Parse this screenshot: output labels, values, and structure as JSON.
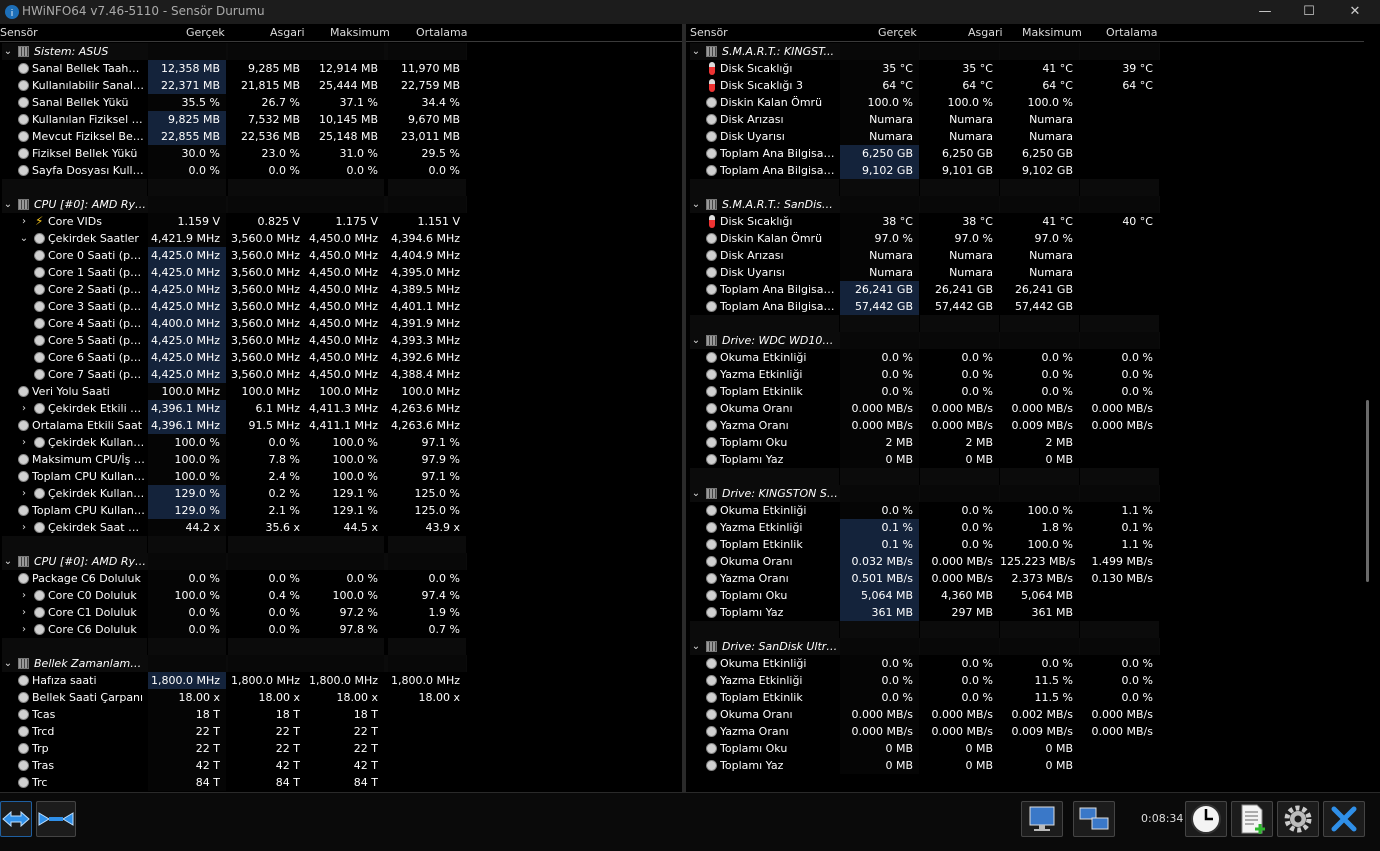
{
  "window": {
    "title": "HWiNFO64 v7.46-5110 - Sensör Durumu",
    "minimize": "—",
    "maximize": "☐",
    "close": "✕"
  },
  "headers": {
    "sensor": "Sensör",
    "current": "Gerçek",
    "min": "Asgari",
    "max": "Maksimum",
    "avg": "Ortalama"
  },
  "status": {
    "timer": "0:08:34"
  },
  "left_rows": [
    {
      "t": "g",
      "n": "Sistem: ASUS"
    },
    {
      "i": "c",
      "n": "Sanal Bellek Taahhüt...",
      "v": [
        "12,358 MB",
        "9,285 MB",
        "12,914 MB",
        "11,970 MB"
      ],
      "h": 1
    },
    {
      "i": "c",
      "n": "Kullanılabilir Sanal Be...",
      "v": [
        "22,371 MB",
        "21,815 MB",
        "25,444 MB",
        "22,759 MB"
      ],
      "h": 1
    },
    {
      "i": "c",
      "n": "Sanal Bellek Yükü",
      "v": [
        "35.5 %",
        "26.7 %",
        "37.1 %",
        "34.4 %"
      ]
    },
    {
      "i": "c",
      "n": "Kullanılan Fiziksel Bellek",
      "v": [
        "9,825 MB",
        "7,532 MB",
        "10,145 MB",
        "9,670 MB"
      ],
      "h": 1
    },
    {
      "i": "c",
      "n": "Mevcut Fiziksel Bellek",
      "v": [
        "22,855 MB",
        "22,536 MB",
        "25,148 MB",
        "23,011 MB"
      ],
      "h": 1
    },
    {
      "i": "c",
      "n": "Fiziksel Bellek Yükü",
      "v": [
        "30.0 %",
        "23.0 %",
        "31.0 %",
        "29.5 %"
      ]
    },
    {
      "i": "c",
      "n": "Sayfa Dosyası Kullanımı",
      "v": [
        "0.0 %",
        "0.0 %",
        "0.0 %",
        "0.0 %"
      ]
    },
    {
      "t": "s"
    },
    {
      "t": "g",
      "n": "CPU [#0]: AMD Ryz..."
    },
    {
      "e": ">",
      "i": "v",
      "n": "Core VIDs",
      "v": [
        "1.159 V",
        "0.825 V",
        "1.175 V",
        "1.151 V"
      ]
    },
    {
      "e": "v",
      "i": "c",
      "n": "Çekirdek Saatler",
      "v": [
        "4,421.9 MHz",
        "3,560.0 MHz",
        "4,450.0 MHz",
        "4,394.6 MHz"
      ]
    },
    {
      "d": 1,
      "i": "c",
      "n": "Core 0 Saati (per...",
      "v": [
        "4,425.0 MHz",
        "3,560.0 MHz",
        "4,450.0 MHz",
        "4,404.9 MHz"
      ],
      "h": 1
    },
    {
      "d": 1,
      "i": "c",
      "n": "Core 1 Saati (per...",
      "v": [
        "4,425.0 MHz",
        "3,560.0 MHz",
        "4,450.0 MHz",
        "4,395.0 MHz"
      ],
      "h": 1
    },
    {
      "d": 1,
      "i": "c",
      "n": "Core 2 Saati (per...",
      "v": [
        "4,425.0 MHz",
        "3,560.0 MHz",
        "4,450.0 MHz",
        "4,389.5 MHz"
      ],
      "h": 1
    },
    {
      "d": 1,
      "i": "c",
      "n": "Core 3 Saati (per...",
      "v": [
        "4,425.0 MHz",
        "3,560.0 MHz",
        "4,450.0 MHz",
        "4,401.1 MHz"
      ],
      "h": 1
    },
    {
      "d": 1,
      "i": "c",
      "n": "Core 4 Saati (per...",
      "v": [
        "4,400.0 MHz",
        "3,560.0 MHz",
        "4,450.0 MHz",
        "4,391.9 MHz"
      ],
      "h": 1
    },
    {
      "d": 1,
      "i": "c",
      "n": "Core 5 Saati (per...",
      "v": [
        "4,425.0 MHz",
        "3,560.0 MHz",
        "4,450.0 MHz",
        "4,393.3 MHz"
      ],
      "h": 1
    },
    {
      "d": 1,
      "i": "c",
      "n": "Core 6 Saati (per...",
      "v": [
        "4,425.0 MHz",
        "3,560.0 MHz",
        "4,450.0 MHz",
        "4,392.6 MHz"
      ],
      "h": 1
    },
    {
      "d": 1,
      "i": "c",
      "n": "Core 7 Saati (per...",
      "v": [
        "4,425.0 MHz",
        "3,560.0 MHz",
        "4,450.0 MHz",
        "4,388.4 MHz"
      ],
      "h": 1
    },
    {
      "i": "c",
      "n": "Veri Yolu Saati",
      "v": [
        "100.0 MHz",
        "100.0 MHz",
        "100.0 MHz",
        "100.0 MHz"
      ]
    },
    {
      "e": ">",
      "i": "c",
      "n": "Çekirdek Etkili Sa...",
      "v": [
        "4,396.1 MHz",
        "6.1 MHz",
        "4,411.3 MHz",
        "4,263.6 MHz"
      ],
      "h": 1
    },
    {
      "i": "c",
      "n": "Ortalama Etkili Saat",
      "v": [
        "4,396.1 MHz",
        "91.5 MHz",
        "4,411.1 MHz",
        "4,263.6 MHz"
      ],
      "h": 1
    },
    {
      "e": ">",
      "i": "c",
      "n": "Çekirdek Kullanım",
      "v": [
        "100.0 %",
        "0.0 %",
        "100.0 %",
        "97.1 %"
      ]
    },
    {
      "i": "c",
      "n": "Maksimum CPU/İş pa...",
      "v": [
        "100.0 %",
        "7.8 %",
        "100.0 %",
        "97.9 %"
      ]
    },
    {
      "i": "c",
      "n": "Toplam CPU Kullanımı",
      "v": [
        "100.0 %",
        "2.4 %",
        "100.0 %",
        "97.1 %"
      ]
    },
    {
      "e": ">",
      "i": "c",
      "n": "Çekirdek Kullanım",
      "v": [
        "129.0 %",
        "0.2 %",
        "129.1 %",
        "125.0 %"
      ],
      "h": 1
    },
    {
      "i": "c",
      "n": "Toplam CPU Kullanımı",
      "v": [
        "129.0 %",
        "2.1 %",
        "129.1 %",
        "125.0 %"
      ],
      "h": 1
    },
    {
      "e": ">",
      "i": "c",
      "n": "Çekirdek Saat Ça...",
      "v": [
        "44.2 x",
        "35.6 x",
        "44.5 x",
        "43.9 x"
      ]
    },
    {
      "t": "s"
    },
    {
      "t": "g",
      "n": "CPU [#0]: AMD Ryz..."
    },
    {
      "i": "c",
      "n": "Package C6 Doluluk",
      "v": [
        "0.0 %",
        "0.0 %",
        "0.0 %",
        "0.0 %"
      ]
    },
    {
      "e": ">",
      "i": "c",
      "n": "Core C0 Doluluk",
      "v": [
        "100.0 %",
        "0.4 %",
        "100.0 %",
        "97.4 %"
      ]
    },
    {
      "e": ">",
      "i": "c",
      "n": "Core C1 Doluluk",
      "v": [
        "0.0 %",
        "0.0 %",
        "97.2 %",
        "1.9 %"
      ]
    },
    {
      "e": ">",
      "i": "c",
      "n": "Core C6 Doluluk",
      "v": [
        "0.0 %",
        "0.0 %",
        "97.8 %",
        "0.7 %"
      ]
    },
    {
      "t": "s"
    },
    {
      "t": "g",
      "n": "Bellek Zamanlamaları"
    },
    {
      "i": "c",
      "n": "Hafıza saati",
      "v": [
        "1,800.0 MHz",
        "1,800.0 MHz",
        "1,800.0 MHz",
        "1,800.0 MHz"
      ],
      "h": 1
    },
    {
      "i": "c",
      "n": "Bellek Saati Çarpanı",
      "v": [
        "18.00 x",
        "18.00 x",
        "18.00 x",
        "18.00 x"
      ]
    },
    {
      "i": "c",
      "n": "Tcas",
      "v": [
        "18 T",
        "18 T",
        "18 T",
        ""
      ]
    },
    {
      "i": "c",
      "n": "Trcd",
      "v": [
        "22 T",
        "22 T",
        "22 T",
        ""
      ]
    },
    {
      "i": "c",
      "n": "Trp",
      "v": [
        "22 T",
        "22 T",
        "22 T",
        ""
      ]
    },
    {
      "i": "c",
      "n": "Tras",
      "v": [
        "42 T",
        "42 T",
        "42 T",
        ""
      ]
    },
    {
      "i": "c",
      "n": "Trc",
      "v": [
        "84 T",
        "84 T",
        "84 T",
        ""
      ]
    }
  ],
  "right_rows": [
    {
      "t": "g",
      "n": "S.M.A.R.T.: KINGST..."
    },
    {
      "i": "t",
      "n": "Disk Sıcaklığı",
      "v": [
        "35 °C",
        "35 °C",
        "41 °C",
        "39 °C"
      ]
    },
    {
      "i": "t",
      "n": "Disk Sıcaklığı 3",
      "v": [
        "64 °C",
        "64 °C",
        "64 °C",
        "64 °C"
      ]
    },
    {
      "i": "c",
      "n": "Diskin Kalan Ömrü",
      "v": [
        "100.0 %",
        "100.0 %",
        "100.0 %",
        ""
      ]
    },
    {
      "i": "c",
      "n": "Disk Arızası",
      "v": [
        "Numara",
        "Numara",
        "Numara",
        ""
      ]
    },
    {
      "i": "c",
      "n": "Disk Uyarısı",
      "v": [
        "Numara",
        "Numara",
        "Numara",
        ""
      ]
    },
    {
      "i": "c",
      "n": "Toplam Ana Bilgisay...",
      "v": [
        "6,250 GB",
        "6,250 GB",
        "6,250 GB",
        ""
      ],
      "h": 1
    },
    {
      "i": "c",
      "n": "Toplam Ana Bilgisay...",
      "v": [
        "9,102 GB",
        "9,101 GB",
        "9,102 GB",
        ""
      ],
      "h": 1
    },
    {
      "t": "s"
    },
    {
      "t": "g",
      "n": "S.M.A.R.T.: SanDisk..."
    },
    {
      "i": "t",
      "n": "Disk Sıcaklığı",
      "v": [
        "38 °C",
        "38 °C",
        "41 °C",
        "40 °C"
      ]
    },
    {
      "i": "c",
      "n": "Diskin Kalan Ömrü",
      "v": [
        "97.0 %",
        "97.0 %",
        "97.0 %",
        ""
      ]
    },
    {
      "i": "c",
      "n": "Disk Arızası",
      "v": [
        "Numara",
        "Numara",
        "Numara",
        ""
      ]
    },
    {
      "i": "c",
      "n": "Disk Uyarısı",
      "v": [
        "Numara",
        "Numara",
        "Numara",
        ""
      ]
    },
    {
      "i": "c",
      "n": "Toplam Ana Bilgisay...",
      "v": [
        "26,241 GB",
        "26,241 GB",
        "26,241 GB",
        ""
      ],
      "h": 1
    },
    {
      "i": "c",
      "n": "Toplam Ana Bilgisay...",
      "v": [
        "57,442 GB",
        "57,442 GB",
        "57,442 GB",
        ""
      ],
      "h": 1
    },
    {
      "t": "s"
    },
    {
      "t": "g",
      "n": "Drive: WDC WD10S..."
    },
    {
      "i": "c",
      "n": "Okuma Etkinliği",
      "v": [
        "0.0 %",
        "0.0 %",
        "0.0 %",
        "0.0 %"
      ]
    },
    {
      "i": "c",
      "n": "Yazma Etkinliği",
      "v": [
        "0.0 %",
        "0.0 %",
        "0.0 %",
        "0.0 %"
      ]
    },
    {
      "i": "c",
      "n": "Toplam Etkinlik",
      "v": [
        "0.0 %",
        "0.0 %",
        "0.0 %",
        "0.0 %"
      ]
    },
    {
      "i": "c",
      "n": "Okuma Oranı",
      "v": [
        "0.000 MB/s",
        "0.000 MB/s",
        "0.000 MB/s",
        "0.000 MB/s"
      ]
    },
    {
      "i": "c",
      "n": "Yazma Oranı",
      "v": [
        "0.000 MB/s",
        "0.000 MB/s",
        "0.009 MB/s",
        "0.000 MB/s"
      ]
    },
    {
      "i": "c",
      "n": "Toplamı Oku",
      "v": [
        "2 MB",
        "2 MB",
        "2 MB",
        ""
      ]
    },
    {
      "i": "c",
      "n": "Toplamı Yaz",
      "v": [
        "0 MB",
        "0 MB",
        "0 MB",
        ""
      ]
    },
    {
      "t": "s"
    },
    {
      "t": "g",
      "n": "Drive: KINGSTON SF..."
    },
    {
      "i": "c",
      "n": "Okuma Etkinliği",
      "v": [
        "0.0 %",
        "0.0 %",
        "100.0 %",
        "1.1 %"
      ]
    },
    {
      "i": "c",
      "n": "Yazma Etkinliği",
      "v": [
        "0.1 %",
        "0.0 %",
        "1.8 %",
        "0.1 %"
      ],
      "h": 1
    },
    {
      "i": "c",
      "n": "Toplam Etkinlik",
      "v": [
        "0.1 %",
        "0.0 %",
        "100.0 %",
        "1.1 %"
      ],
      "h": 1
    },
    {
      "i": "c",
      "n": "Okuma Oranı",
      "v": [
        "0.032 MB/s",
        "0.000 MB/s",
        "125.223 MB/s",
        "1.499 MB/s"
      ],
      "h": 1
    },
    {
      "i": "c",
      "n": "Yazma Oranı",
      "v": [
        "0.501 MB/s",
        "0.000 MB/s",
        "2.373 MB/s",
        "0.130 MB/s"
      ],
      "h": 1
    },
    {
      "i": "c",
      "n": "Toplamı Oku",
      "v": [
        "5,064 MB",
        "4,360 MB",
        "5,064 MB",
        ""
      ],
      "h": 1
    },
    {
      "i": "c",
      "n": "Toplamı Yaz",
      "v": [
        "361 MB",
        "297 MB",
        "361 MB",
        ""
      ],
      "h": 1
    },
    {
      "t": "s"
    },
    {
      "t": "g",
      "n": "Drive: SanDisk Ultra ..."
    },
    {
      "i": "c",
      "n": "Okuma Etkinliği",
      "v": [
        "0.0 %",
        "0.0 %",
        "0.0 %",
        "0.0 %"
      ]
    },
    {
      "i": "c",
      "n": "Yazma Etkinliği",
      "v": [
        "0.0 %",
        "0.0 %",
        "11.5 %",
        "0.0 %"
      ]
    },
    {
      "i": "c",
      "n": "Toplam Etkinlik",
      "v": [
        "0.0 %",
        "0.0 %",
        "11.5 %",
        "0.0 %"
      ]
    },
    {
      "i": "c",
      "n": "Okuma Oranı",
      "v": [
        "0.000 MB/s",
        "0.000 MB/s",
        "0.002 MB/s",
        "0.000 MB/s"
      ]
    },
    {
      "i": "c",
      "n": "Yazma Oranı",
      "v": [
        "0.000 MB/s",
        "0.000 MB/s",
        "0.009 MB/s",
        "0.000 MB/s"
      ]
    },
    {
      "i": "c",
      "n": "Toplamı Oku",
      "v": [
        "0 MB",
        "0 MB",
        "0 MB",
        ""
      ]
    },
    {
      "i": "c",
      "n": "Toplamı Yaz",
      "v": [
        "0 MB",
        "0 MB",
        "0 MB",
        ""
      ]
    }
  ]
}
